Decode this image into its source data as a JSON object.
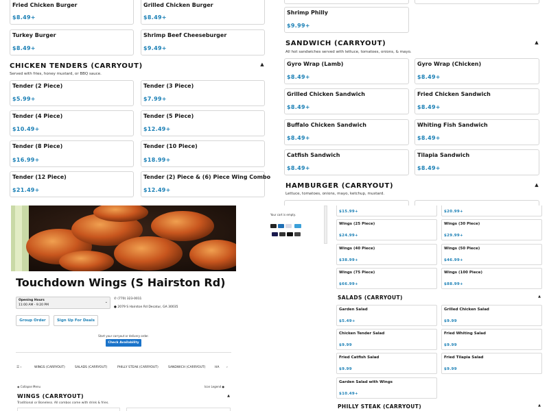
{
  "top_left": {
    "cards": [
      {
        "name": "Fried Chicken Burger",
        "price": "$8.49+"
      },
      {
        "name": "Grilled Chicken Burger",
        "price": "$8.49+"
      },
      {
        "name": "Turkey Burger",
        "price": "$8.49+"
      },
      {
        "name": "Shrimp Beef Cheeseburger",
        "price": "$9.49+"
      }
    ],
    "tenders_section": {
      "title": "CHICKEN TENDERS (CARRYOUT)",
      "description": "Served with fries, honey mustard, or BBQ sauce.",
      "items": [
        {
          "name": "Tender (2 Piece)",
          "price": "$5.99+"
        },
        {
          "name": "Tender (3 Piece)",
          "price": "$7.99+"
        },
        {
          "name": "Tender (4 Piece)",
          "price": "$10.49+"
        },
        {
          "name": "Tender (5 Piece)",
          "price": "$12.49+"
        },
        {
          "name": "Tender (8 Piece)",
          "price": "$16.99+"
        },
        {
          "name": "Tender (10 Piece)",
          "price": "$18.99+"
        },
        {
          "name": "Tender (12 Piece)",
          "price": "$21.49+"
        },
        {
          "name": "Tender (2) Piece & (6) Piece Wing Combo",
          "price": "$12.49+"
        }
      ]
    }
  },
  "top_right": {
    "shrimp_card": {
      "name": "Shrimp Philly",
      "price": "$9.99+"
    },
    "sandwich_section": {
      "title": "SANDWICH (CARRYOUT)",
      "description": "All hot sandwiches served with lettuce, tomatoes, onions, & mayo.",
      "items": [
        {
          "name": "Gyro Wrap (Lamb)",
          "price": "$8.49+"
        },
        {
          "name": "Gyro Wrap (Chicken)",
          "price": "$8.49+"
        },
        {
          "name": "Grilled Chicken Sandwich",
          "price": "$8.49+"
        },
        {
          "name": "Fried Chicken Sandwich",
          "price": "$8.49+"
        },
        {
          "name": "Buffalo Chicken Sandwich",
          "price": "$8.49+"
        },
        {
          "name": "Whiting Fish Sandwich",
          "price": "$8.49+"
        },
        {
          "name": "Catfish Sandwich",
          "price": "$8.49+"
        },
        {
          "name": "Tilapia Sandwich",
          "price": "$8.49+"
        }
      ]
    },
    "hamburger_section": {
      "title": "HAMBURGER (CARRYOUT)",
      "description": "Lettuce, tomatoes, onions, mayo, ketchup, mustard."
    }
  },
  "storefront": {
    "name": "Touchdown Wings (S Hairston Rd)",
    "hours_label": "Opening Hours",
    "hours_value": "11:00 AM - 9:20 PM",
    "phone": "(770) 323-0011",
    "address": "2079 S Hairston Rd Decatur, GA 30035",
    "group_order": "Group Order",
    "sign_up": "Sign Up For Deals",
    "start_text": "Start your carryout or delivery order.",
    "check_availability": "Check Availability",
    "cart_empty": "Your cart is empty.",
    "tabs": [
      "WINGS (CARRYOUT)",
      "SALADS (CARRYOUT)",
      "PHILLY STEAK (CARRYOUT)",
      "SANDWICH (CARRYOUT)",
      "HA"
    ],
    "collapse_menu": "Collapse Menu",
    "icon_legend": "Icon Legend",
    "wings_title": "WINGS (CARRYOUT)",
    "wings_desc": "Traditional or Boneless. All combos come with drink & fries."
  },
  "bottom_right": {
    "wings_items": [
      {
        "name": "",
        "price": "$15.99+"
      },
      {
        "name": "",
        "price": "$20.99+"
      },
      {
        "name": "Wings (25 Piece)",
        "price": "$24.99+"
      },
      {
        "name": "Wings (30 Piece)",
        "price": "$29.99+"
      },
      {
        "name": "Wings (40 Piece)",
        "price": "$38.99+"
      },
      {
        "name": "Wings (50 Piece)",
        "price": "$46.99+"
      },
      {
        "name": "Wings (75 Piece)",
        "price": "$66.99+"
      },
      {
        "name": "Wings (100 Piece)",
        "price": "$88.99+"
      }
    ],
    "salads_section": {
      "title": "SALADS (CARRYOUT)",
      "items": [
        {
          "name": "Garden Salad",
          "price": "$5.49+"
        },
        {
          "name": "Grilled Chicken Salad",
          "price": "$9.99"
        },
        {
          "name": "Chicken Tender Salad",
          "price": "$9.99"
        },
        {
          "name": "Fried Whiting Salad",
          "price": "$9.99"
        },
        {
          "name": "Fried Catfish Salad",
          "price": "$9.99"
        },
        {
          "name": "Fried Tilapia Salad",
          "price": "$9.99"
        },
        {
          "name": "Garden Salad with Wings",
          "price": "$10.49+"
        }
      ]
    },
    "philly_title": "PHILLY STEAK (CARRYOUT)"
  },
  "colors": {
    "price": "#1a7fb5",
    "accent_button": "#1a73c9",
    "card_border": "#d6d6d6"
  }
}
